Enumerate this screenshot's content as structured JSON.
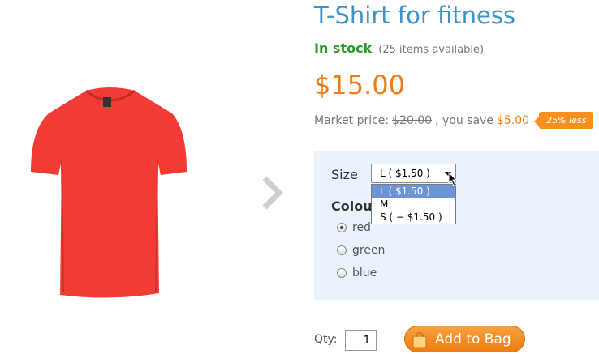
{
  "product": {
    "title": "T-Shirt for fitness",
    "stock_status": "In stock",
    "availability": "(25 items available)",
    "price": "$15.00",
    "market_price_label": "Market price:",
    "market_price": "$20.00",
    "you_save_label": ", you save",
    "save_amount": "$5.00",
    "discount_badge": "25% less",
    "image_color": "#f03c34"
  },
  "options": {
    "size_label": "Size",
    "size_selected": "L ( $1.50 )",
    "size_options": [
      "L ( $1.50 )",
      "M",
      "S ( − $1.50 )"
    ],
    "colour_label": "Colour",
    "colours": [
      {
        "label": "red",
        "checked": true
      },
      {
        "label": "green",
        "checked": false
      },
      {
        "label": "blue",
        "checked": false
      }
    ]
  },
  "purchase": {
    "qty_label": "Qty:",
    "qty_value": "1",
    "add_button_label": "Add to Bag"
  },
  "colors": {
    "accent_orange": "#f07c14",
    "title_blue": "#3e94c8",
    "stock_green": "#2a9a2a",
    "panel_bg": "#eaf3fb"
  }
}
